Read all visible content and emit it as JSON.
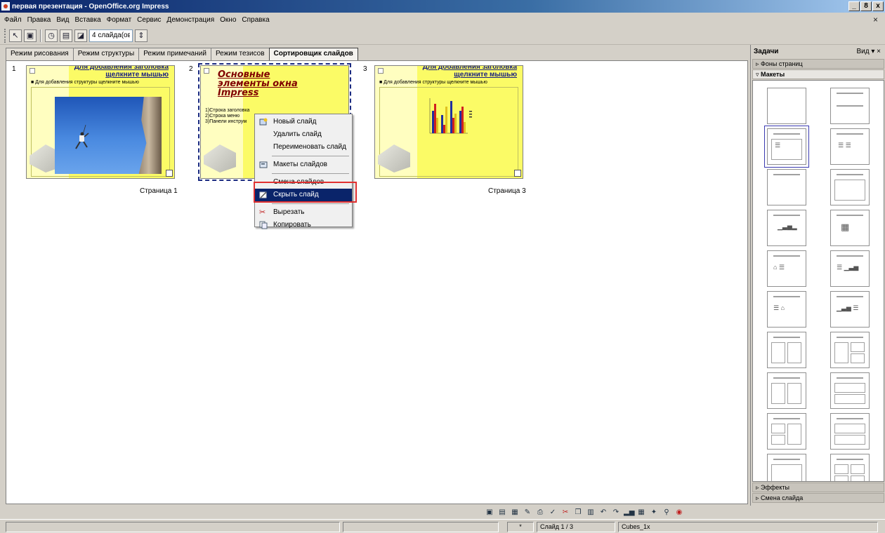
{
  "window": {
    "title": "первая презентация - OpenOffice.org Impress",
    "buttons": [
      "_",
      "8",
      "x"
    ],
    "doc_close": "×"
  },
  "menu": [
    "Файл",
    "Правка",
    "Вид",
    "Вставка",
    "Формат",
    "Сервис",
    "Демонстрация",
    "Окно",
    "Справка"
  ],
  "toolbar": {
    "slides_per_row": "4 слайда(ов)"
  },
  "tabs": [
    {
      "label": "Режим рисования"
    },
    {
      "label": "Режим структуры"
    },
    {
      "label": "Режим примечаний"
    },
    {
      "label": "Режим тезисов"
    },
    {
      "label": "Сортировщик слайдов",
      "active": true
    }
  ],
  "slides": [
    {
      "number": "1",
      "title": "Для добавления заголовка щелкните мышью",
      "subtitle": "■ Для добавления структуры щелкните мышью",
      "page_label": "Страница 1"
    },
    {
      "number": "2",
      "title": "Основные элементы окна Impress",
      "list": [
        "1)Строка заголовка",
        "2)Строка меню",
        "3)Панели инструм"
      ],
      "selected": true
    },
    {
      "number": "3",
      "title": "Для добавления заголовка щелкните мышью",
      "subtitle": "■ Для добавления структуры щелкните мышью",
      "page_label": "Страница 3"
    }
  ],
  "context_menu": {
    "items": [
      {
        "label": "Новый слайд",
        "icon": "new-slide-icon"
      },
      {
        "label": "Удалить слайд"
      },
      {
        "label": "Переименовать слайд"
      },
      {
        "label": "Макеты слайдов",
        "icon": "layouts-icon"
      },
      {
        "label": "Смена слайдов"
      },
      {
        "label": "Скрыть слайд",
        "icon": "hide-slide-icon",
        "highlighted": true
      },
      {
        "label": "Вырезать",
        "icon": "scissors-icon"
      },
      {
        "label": "Копировать",
        "icon": "copy-icon"
      }
    ]
  },
  "task_pane": {
    "title": "Задачи",
    "view_label": "Вид ▾ ×",
    "sections": {
      "backgrounds": "Фоны страниц",
      "layouts": "Макеты",
      "effects": "Эффекты",
      "transition": "Смена слайда"
    }
  },
  "status": {
    "slide": "Слайд 1 / 3",
    "design": "Cubes_1x",
    "marker": "*"
  },
  "colors": {
    "slide_bg": "#fbfb66",
    "highlight": "#0a246a",
    "annotation": "#e03030"
  }
}
